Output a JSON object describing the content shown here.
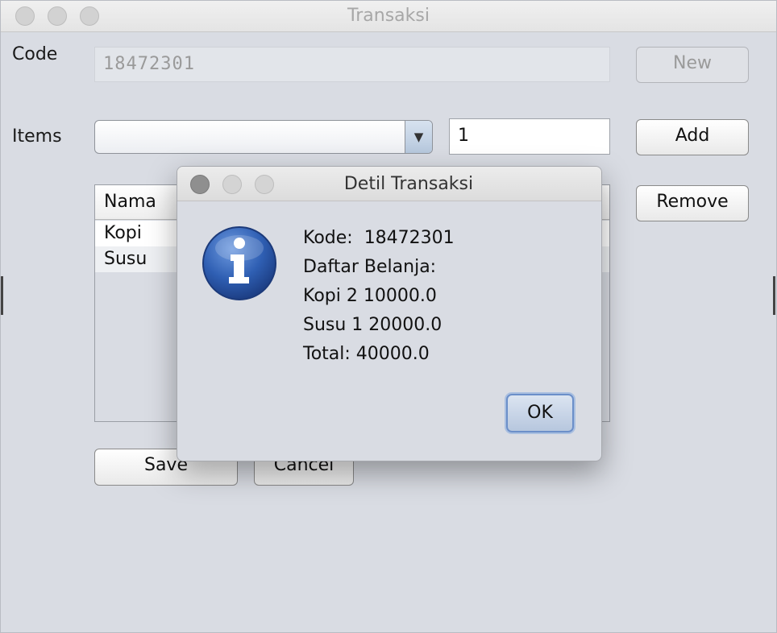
{
  "window": {
    "title": "Transaksi"
  },
  "form": {
    "code_label": "Code",
    "code_value": "18472301",
    "new_button": "New",
    "items_label": "Items",
    "items_selected": "",
    "quantity_value": "1",
    "add_button": "Add",
    "remove_button": "Remove",
    "save_button": "Save",
    "cancel_button": "Cancel"
  },
  "table": {
    "columns": [
      "Nama"
    ],
    "rows": [
      {
        "nama": "Kopi"
      },
      {
        "nama": "Susu"
      }
    ]
  },
  "dialog": {
    "title": "Detil Transaksi",
    "icon": "info-icon",
    "lines": [
      "Kode:  18472301",
      "Daftar Belanja:",
      "Kopi 2 10000.0",
      "Susu 1 20000.0",
      "Total: 40000.0"
    ],
    "ok_button": "OK"
  },
  "colors": {
    "window_bg": "#d9dce3",
    "info_icon_blue": "#2f5fb3",
    "ok_button_border": "#6b8fc9"
  }
}
